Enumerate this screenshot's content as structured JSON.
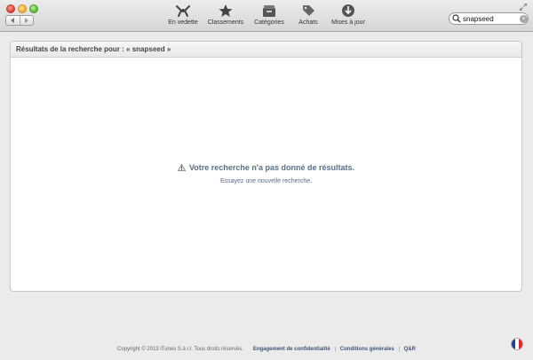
{
  "toolbar": {
    "items": [
      {
        "label": "En vedette",
        "icon": "featured-icon"
      },
      {
        "label": "Classements",
        "icon": "star-icon"
      },
      {
        "label": "Catégories",
        "icon": "categories-icon"
      },
      {
        "label": "Achats",
        "icon": "purchases-icon"
      },
      {
        "label": "Mises à jour",
        "icon": "updates-icon"
      }
    ],
    "search": {
      "value": "snapseed",
      "placeholder": ""
    }
  },
  "results": {
    "header": "Résultats de la recherche pour : « snapseed »",
    "empty_title": "Votre recherche n'a pas donné de résultats.",
    "empty_subtitle": "Essayez une nouvelle recherche."
  },
  "footer": {
    "copyright": "Copyright © 2013 iTunes S.à r.l. Tous droits réservés.",
    "links": [
      "Engagement de confidentialité",
      "Conditions générales",
      "Q&R"
    ]
  },
  "colors": {
    "link": "#3f5577",
    "empty_text": "#5a6e8c"
  }
}
